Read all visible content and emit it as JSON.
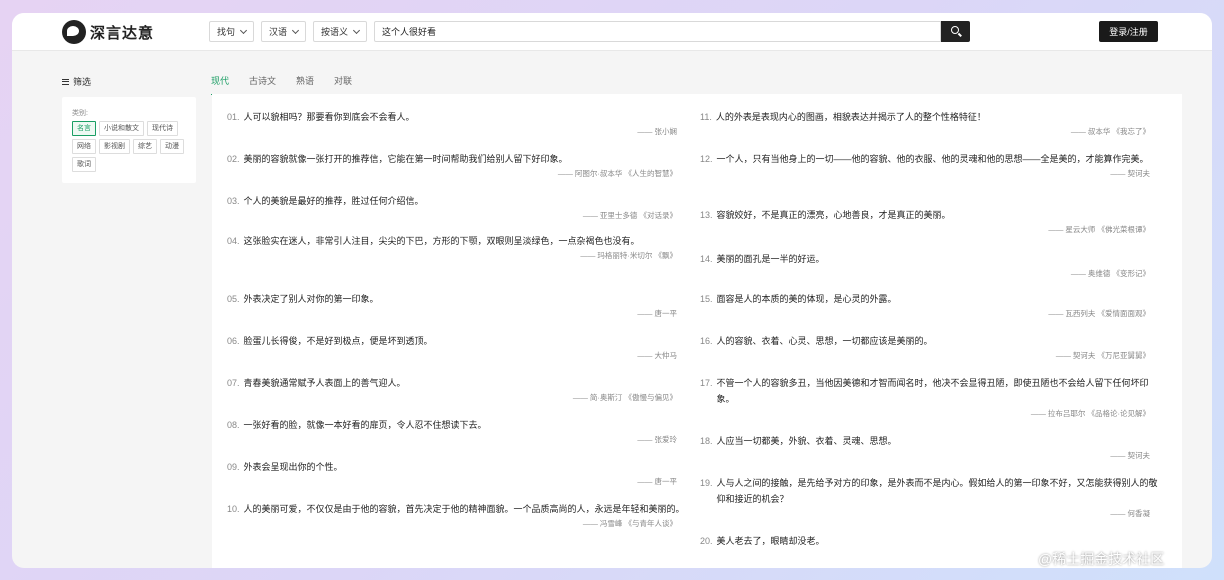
{
  "header": {
    "logo_text": "深言达意",
    "dropdowns": [
      {
        "label": "找句"
      },
      {
        "label": "汉语"
      },
      {
        "label": "按语义"
      }
    ],
    "search": {
      "value": "这个人很好看"
    },
    "login_label": "登录/注册"
  },
  "sidebar": {
    "title": "筛选",
    "category_label": "类别:",
    "tags": [
      {
        "label": "名言",
        "active": true
      },
      {
        "label": "小说和散文",
        "active": false
      },
      {
        "label": "现代诗",
        "active": false
      },
      {
        "label": "网络",
        "active": false
      },
      {
        "label": "影视剧",
        "active": false
      },
      {
        "label": "综艺",
        "active": false
      },
      {
        "label": "动漫",
        "active": false
      },
      {
        "label": "歌词",
        "active": false
      }
    ]
  },
  "tabs": [
    {
      "label": "现代",
      "active": true
    },
    {
      "label": "古诗文",
      "active": false
    },
    {
      "label": "熟语",
      "active": false
    },
    {
      "label": "对联",
      "active": false
    }
  ],
  "quotes_left": [
    {
      "num": "01.",
      "text": "人可以貌相吗？那要看你到底会不会看人。",
      "source": "—— 张小娴"
    },
    {
      "num": "02.",
      "text": "美丽的容貌就像一张打开的推荐信，它能在第一时间帮助我们给别人留下好印象。",
      "source": "—— 阿图尔·叔本华 《人生的智慧》"
    },
    {
      "num": "03.",
      "text": "个人的美貌是最好的推荐，胜过任何介绍信。",
      "source": "—— 亚里士多德 《对话录》"
    },
    {
      "num": "04.",
      "text": "这张脸实在迷人，非常引人注目，尖尖的下巴，方形的下颚，双眼则呈淡绿色，一点杂褐色也没有。",
      "source": "—— 玛格丽特·米切尔 《飘》"
    },
    {
      "num": "05.",
      "text": "外表决定了别人对你的第一印象。",
      "source": "—— 唐一平"
    },
    {
      "num": "06.",
      "text": "脸蛋儿长得俊，不是好到极点，便是坏到透顶。",
      "source": "—— 大仲马"
    },
    {
      "num": "07.",
      "text": "青春美貌通常赋予人表面上的善气迎人。",
      "source": "—— 简·奥斯汀 《傲慢与偏见》"
    },
    {
      "num": "08.",
      "text": "一张好看的脸，就像一本好看的扉页，令人忍不住想读下去。",
      "source": "—— 张爱玲"
    },
    {
      "num": "09.",
      "text": "外表会呈现出你的个性。",
      "source": "—— 唐一平"
    },
    {
      "num": "10.",
      "text": "人的美丽可爱，不仅仅是由于他的容貌，首先决定于他的精神面貌。一个品质高尚的人，永远是年轻和美丽的。",
      "source": "—— 冯雪峰 《与青年人谈》"
    }
  ],
  "quotes_right": [
    {
      "num": "11.",
      "text": "人的外表是表现内心的图画，相貌表达并揭示了人的整个性格特征！",
      "source": "—— 叔本华 《我忘了》"
    },
    {
      "num": "12.",
      "text": "一个人，只有当他身上的一切——他的容貌、他的衣服、他的灵魂和他的思想——全是美的，才能算作完美。",
      "source": "—— 契诃夫"
    },
    {
      "num": "13.",
      "text": "容貌姣好，不是真正的漂亮，心地善良，才是真正的美丽。",
      "source": "—— 星云大师 《佛光菜根谭》"
    },
    {
      "num": "14.",
      "text": "美丽的面孔是一半的好运。",
      "source": "—— 奥维德 《变形记》"
    },
    {
      "num": "15.",
      "text": "面容是人的本质的美的体现，是心灵的外露。",
      "source": "—— 瓦西列夫 《爱情面面观》"
    },
    {
      "num": "16.",
      "text": "人的容貌、衣着、心灵、思想，一切都应该是美丽的。",
      "source": "—— 契诃夫 《万尼亚舅舅》"
    },
    {
      "num": "17.",
      "text": "不管一个人的容貌多丑，当他因美德和才智而闻名时，他决不会显得丑陋，即使丑陋也不会给人留下任何坏印象。",
      "source": "—— 拉布吕耶尔 《品格论·论见解》"
    },
    {
      "num": "18.",
      "text": "人应当一切都美，外貌、衣着、灵魂、思想。",
      "source": "—— 契诃夫"
    },
    {
      "num": "19.",
      "text": "人与人之间的接触，是先给予对方的印象，是外表而不是内心。假如给人的第一印象不好，又怎能获得别人的敬仰和接近的机会？",
      "source": "—— 何香凝"
    },
    {
      "num": "20.",
      "text": "美人老去了，眼睛却没老。",
      "source": ""
    }
  ],
  "watermark": "@稀土掘金技术社区"
}
